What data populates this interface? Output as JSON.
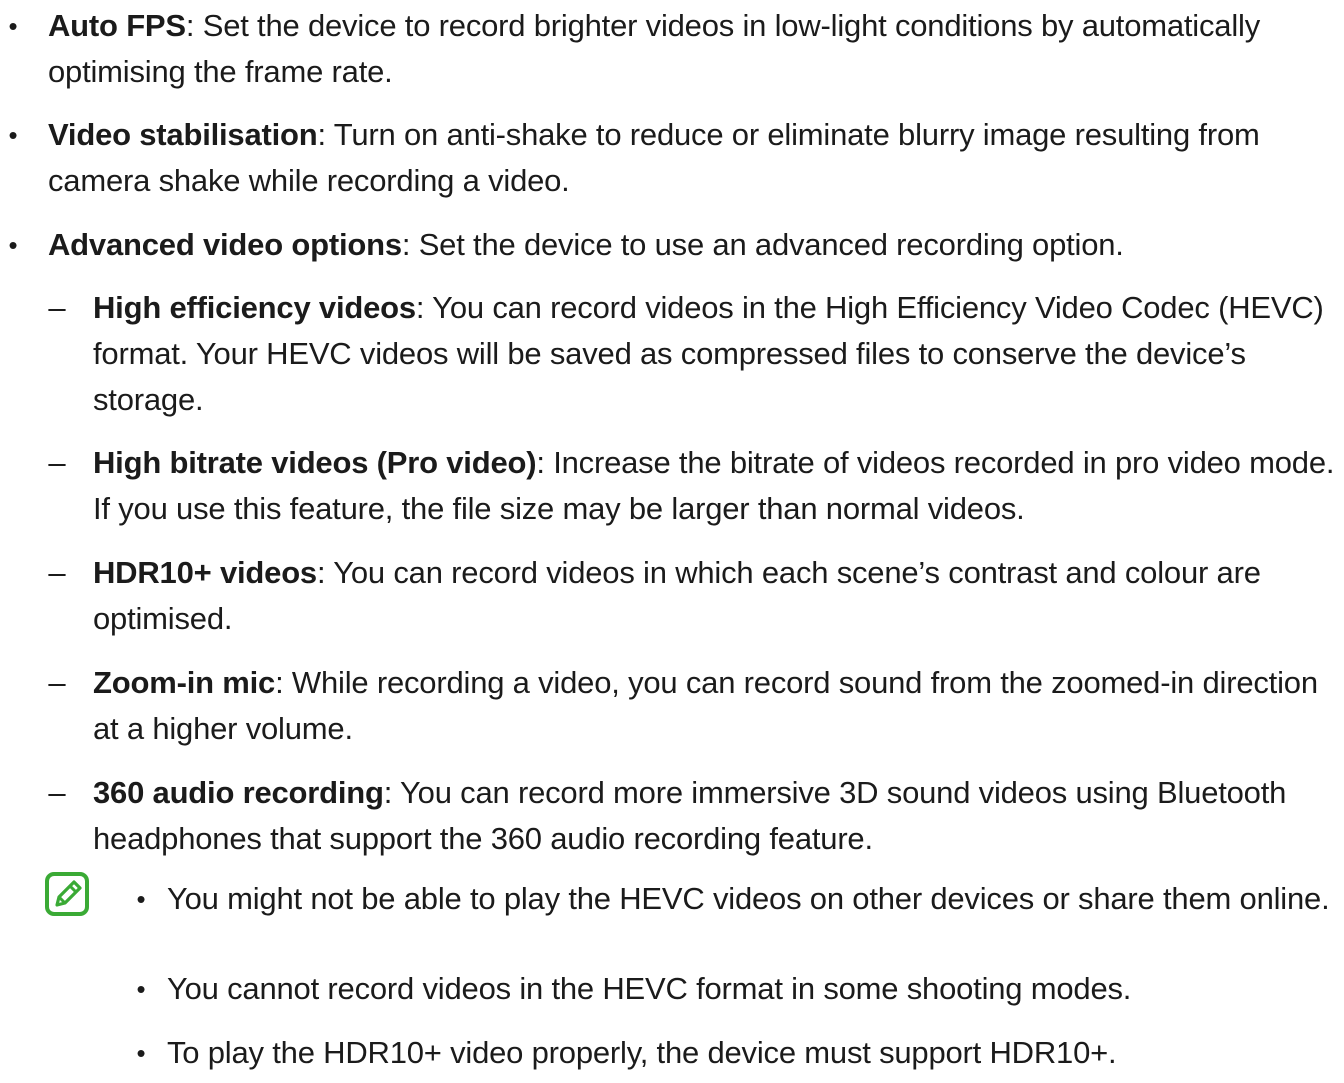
{
  "items": [
    {
      "term": "Auto FPS",
      "text": ": Set the device to record brighter videos in low-light conditions by automatically optimising the frame rate."
    },
    {
      "term": "Video stabilisation",
      "text": ": Turn on anti-shake to reduce or eliminate blurry image resulting from camera shake while recording a video."
    },
    {
      "term": "Advanced video options",
      "text": ": Set the device to use an advanced recording option."
    }
  ],
  "sub_items": [
    {
      "term": "High efficiency videos",
      "text": ": You can record videos in the High Efficiency Video Codec (HEVC) format. Your HEVC videos will be saved as compressed files to conserve the device’s storage."
    },
    {
      "term": "High bitrate videos (Pro video)",
      "text": ": Increase the bitrate of videos recorded in pro video mode. If you use this feature, the file size may be larger than normal videos."
    },
    {
      "term": "HDR10+ videos",
      "text": ": You can record videos in which each scene’s contrast and colour are optimised."
    },
    {
      "term": "Zoom-in mic",
      "text": ": While recording a video, you can record sound from the zoomed-in direction at a higher volume."
    },
    {
      "term": "360 audio recording",
      "text": ": You can record more immersive 3D sound videos using Bluetooth headphones that support the 360 audio recording feature."
    }
  ],
  "markers": {
    "bullet": "•",
    "dash": "–"
  },
  "notes": [
    "You might not be able to play the HEVC videos on other devices or share them online.",
    "You cannot record videos in the HEVC format in some shooting modes.",
    "To play the HDR10+ video properly, the device must support HDR10+."
  ],
  "note_icon": "note-pencil-icon",
  "colors": {
    "text": "#1b1b1b",
    "note_icon": "#3aaa35"
  }
}
